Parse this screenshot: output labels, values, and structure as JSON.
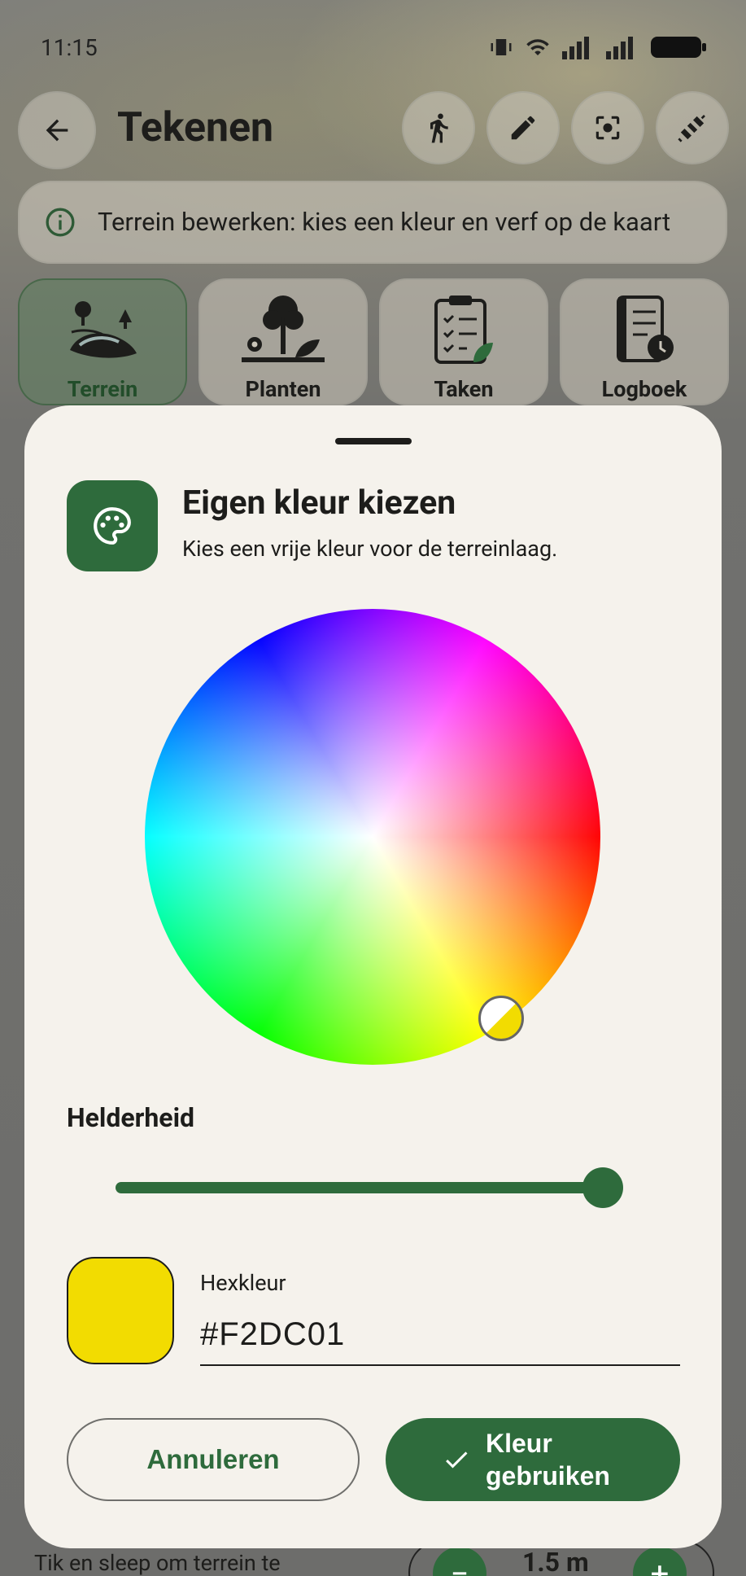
{
  "status_bar": {
    "time": "11:15"
  },
  "header": {
    "title": "Tekenen",
    "actions": [
      "walk-icon",
      "pencil-icon",
      "focus-icon",
      "satellite-icon"
    ]
  },
  "info_banner": {
    "text": "Terrein bewerken: kies een kleur en verf op de kaart"
  },
  "tabs": [
    {
      "label": "Terrein",
      "active": true
    },
    {
      "label": "Planten",
      "active": false
    },
    {
      "label": "Taken",
      "active": false
    },
    {
      "label": "Logboek",
      "active": false
    }
  ],
  "sheet": {
    "title": "Eigen kleur kiezen",
    "subtitle": "Kies een vrije kleur voor de terreinlaag.",
    "brightness_label": "Helderheid",
    "brightness_value": 1.0,
    "hex_label": "Hexkleur",
    "hex_value": "#F2DC01",
    "selected_color": "#F2DC01",
    "cancel_label": "Annuleren",
    "confirm_label": "Kleur gebruiken"
  },
  "behind": {
    "hint": "Tik en sleep om terrein te",
    "size_value": "1.5 m"
  },
  "colors": {
    "accent": "#2E6B3C",
    "sheet_bg": "#F5F2EC"
  }
}
